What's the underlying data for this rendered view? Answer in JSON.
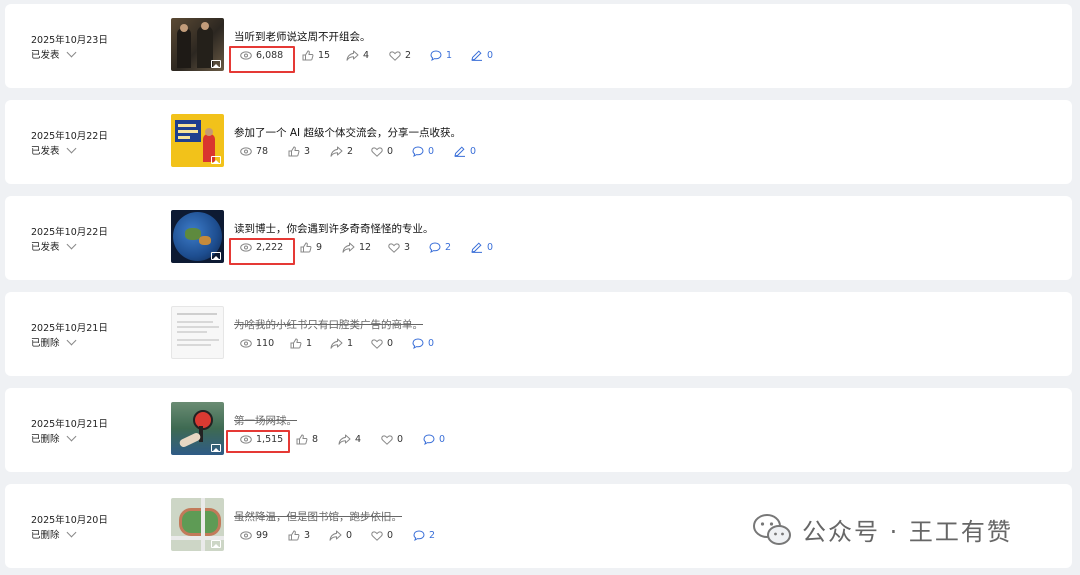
{
  "posts": [
    {
      "date": "2025年10月23日",
      "status": "已发表",
      "title": "当听到老师说这周不开组会。",
      "deleted": false,
      "views": "6,088",
      "likes": "15",
      "shares": "4",
      "loves": "2",
      "comments": "1",
      "edits": "0"
    },
    {
      "date": "2025年10月22日",
      "status": "已发表",
      "title": "参加了一个 AI 超级个体交流会，分享一点收获。",
      "deleted": false,
      "views": "78",
      "likes": "3",
      "shares": "2",
      "loves": "0",
      "comments": "0",
      "edits": "0"
    },
    {
      "date": "2025年10月22日",
      "status": "已发表",
      "title": "读到博士，你会遇到许多奇奇怪怪的专业。",
      "deleted": false,
      "views": "2,222",
      "likes": "9",
      "shares": "12",
      "loves": "3",
      "comments": "2",
      "edits": "0"
    },
    {
      "date": "2025年10月21日",
      "status": "已删除",
      "title": "为啥我的小红书只有口腔类广告的商单。",
      "deleted": true,
      "views": "110",
      "likes": "1",
      "shares": "1",
      "loves": "0",
      "comments": "0"
    },
    {
      "date": "2025年10月21日",
      "status": "已删除",
      "title": "第一场网球。",
      "deleted": true,
      "views": "1,515",
      "likes": "8",
      "shares": "4",
      "loves": "0",
      "comments": "0"
    },
    {
      "date": "2025年10月20日",
      "status": "已删除",
      "title": "虽然降温，但是图书馆，跑步依旧。",
      "deleted": true,
      "views": "99",
      "likes": "3",
      "shares": "0",
      "loves": "0",
      "comments": "2"
    }
  ],
  "thumb_colors": [
    "#3b352c",
    "#f2c21a",
    "#2a5aa8",
    "#f4f4f4",
    "#4f7f62",
    "#c9d3c2"
  ],
  "watermark": {
    "text": "公众号 · 王工有赞",
    "icon": "wechat-icon"
  },
  "highlight_color": "#e53935",
  "link_color": "#3a6fd8"
}
